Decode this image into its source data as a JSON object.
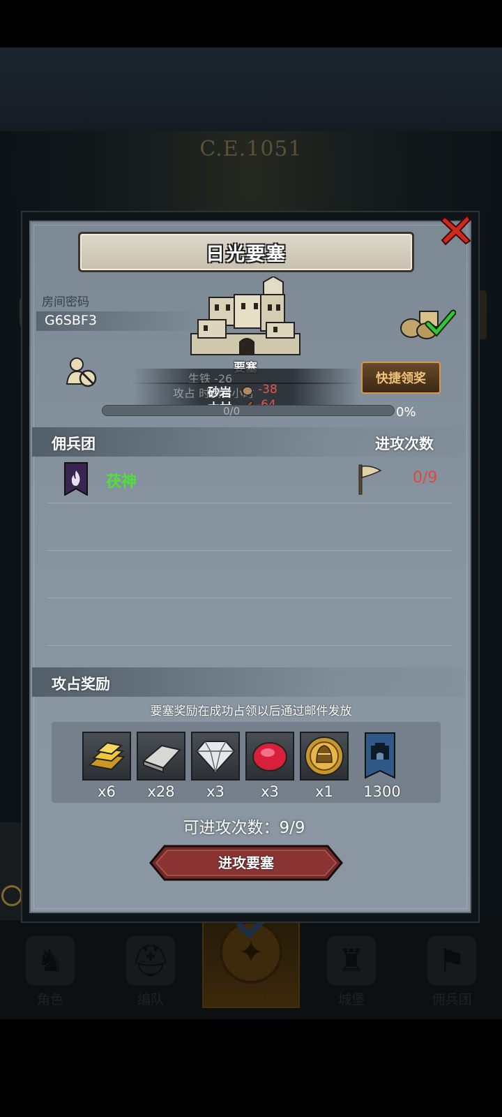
{
  "background": {
    "era": "C.E.1051"
  },
  "bottom_nav": [
    {
      "label": "角色",
      "icon": "knight-icon"
    },
    {
      "label": "编队",
      "icon": "helmet-icon"
    },
    {
      "label": "前往群岛",
      "icon": "compass-icon",
      "active": true
    },
    {
      "label": "城堡",
      "icon": "castle-icon"
    },
    {
      "label": "佣兵团",
      "icon": "banner-icon"
    }
  ],
  "dialog": {
    "title": "日光要塞",
    "room_label": "房间密码",
    "room_code": "G6SBF3",
    "castle_label": "要塞",
    "quick_claim_label": "快捷领奖",
    "resources": {
      "ghost_top": "生铁 -26",
      "ghost_mid": "攻占   时间 4小时",
      "ghost_bottom": "0/0",
      "stone_name": "砂岩",
      "stone_value": "-38",
      "wood_name": "木材",
      "wood_value": "-64"
    },
    "progress_percent": "0%",
    "progress_fraction": 0,
    "mercenary_section": {
      "title": "佣兵团",
      "attack_count_title": "进攻次数",
      "rows": [
        {
          "name": "茯神",
          "count": "0/9"
        }
      ]
    },
    "reward_section": {
      "title": "攻占奖励",
      "note": "要塞奖励在成功占领以后通过邮件发放",
      "items": [
        {
          "icon": "gold-bar-icon",
          "qty": "x6"
        },
        {
          "icon": "iron-ingot-icon",
          "qty": "x28"
        },
        {
          "icon": "diamond-icon",
          "qty": "x3"
        },
        {
          "icon": "ruby-icon",
          "qty": "x3"
        },
        {
          "icon": "gold-coin-icon",
          "qty": "x1"
        },
        {
          "icon": "fortress-banner-icon",
          "qty": "1300"
        }
      ]
    },
    "attacks_available": "可进攻次数：9/9",
    "attack_button_label": "进攻要塞"
  }
}
